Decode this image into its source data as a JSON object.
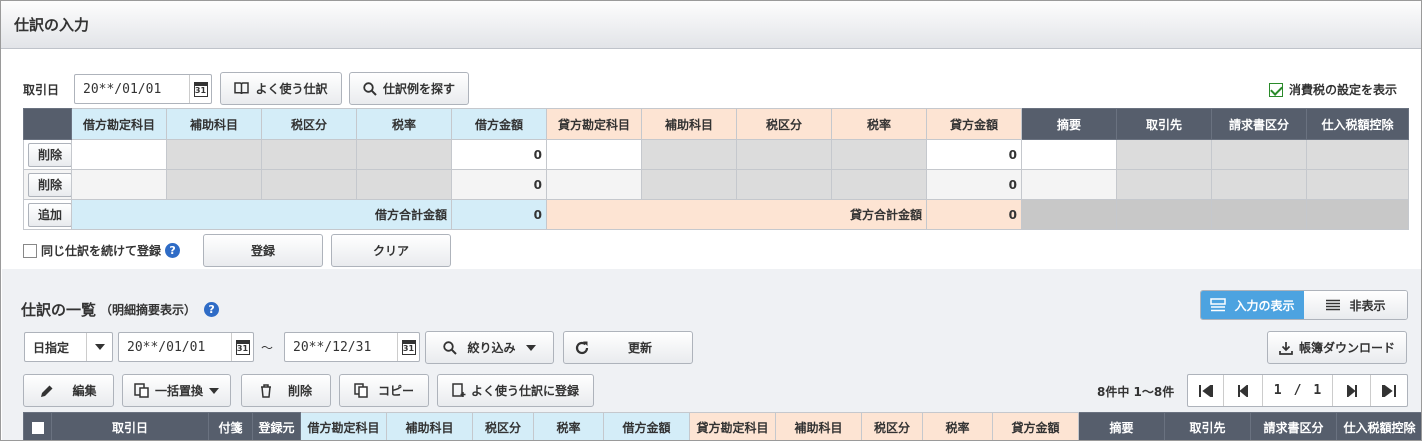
{
  "page_title": "仕訳の入力",
  "entry": {
    "date_label": "取引日",
    "date_value": "20**/01/01",
    "favorite_btn": "よく使う仕訳",
    "search_btn": "仕訳例を探す",
    "tax_setting_label": "消費税の設定を表示",
    "tax_setting_checked": true,
    "columns": [
      "借方勘定科目",
      "補助科目",
      "税区分",
      "税率",
      "借方金額",
      "貸方勘定科目",
      "補助科目",
      "税区分",
      "税率",
      "貸方金額",
      "摘要",
      "取引先",
      "請求書区分",
      "仕入税額控除"
    ],
    "rows": [
      {
        "action": "削除",
        "debit_amount": "0",
        "credit_amount": "0"
      },
      {
        "action": "削除",
        "debit_amount": "0",
        "credit_amount": "0"
      }
    ],
    "add_btn": "追加",
    "debit_total_label": "借方合計金額",
    "debit_total": "0",
    "credit_total_label": "貸方合計金額",
    "credit_total": "0",
    "continue_label": "同じ仕訳を続けて登録",
    "register_btn": "登録",
    "clear_btn": "クリア"
  },
  "list": {
    "title": "仕訳の一覧",
    "subtitle": "（明細摘要表示）",
    "toggle_show": "入力の表示",
    "toggle_hide": "非表示",
    "date_mode": "日指定",
    "date_from": "20**/01/01",
    "tilde": "～",
    "date_to": "20**/12/31",
    "filter_btn": "絞り込み",
    "refresh_btn": "更新",
    "download_btn": "帳簿ダウンロード",
    "edit_btn": "編集",
    "replace_btn": "一括置換",
    "delete_btn": "削除",
    "copy_btn": "コピー",
    "register_fav_btn": "よく使う仕訳に登録",
    "count_text": "8件中 1～8件",
    "page_current": "1",
    "page_sep": "/",
    "page_total": "1",
    "columns": [
      "取引日",
      "付箋",
      "登録元",
      "借方勘定科目",
      "補助科目",
      "税区分",
      "税率",
      "借方金額",
      "貸方勘定科目",
      "補助科目",
      "税区分",
      "税率",
      "貸方金額",
      "摘要",
      "取引先",
      "請求書区分",
      "仕入税額控除"
    ]
  }
}
